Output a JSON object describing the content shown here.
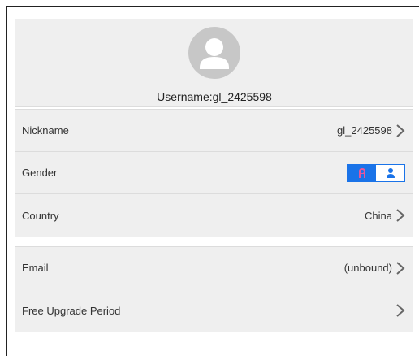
{
  "profile": {
    "username_text": "Username:gl_2425598",
    "avatar_icon": "default-user-avatar-icon"
  },
  "rows": {
    "nickname": {
      "label": "Nickname",
      "value": "gl_2425598"
    },
    "gender": {
      "label": "Gender",
      "options": [
        "female",
        "male"
      ],
      "selected": "female"
    },
    "country": {
      "label": "Country",
      "value": "China"
    },
    "email": {
      "label": "Email",
      "value": "(unbound)"
    },
    "upgrade": {
      "label": "Free Upgrade Period",
      "value": ""
    }
  },
  "colors": {
    "accent": "#1a73e8",
    "female_icon": "#e8579b",
    "male_icon": "#1a73e8",
    "row_bg": "#efefef",
    "avatar_bg": "#c7c7c7"
  }
}
